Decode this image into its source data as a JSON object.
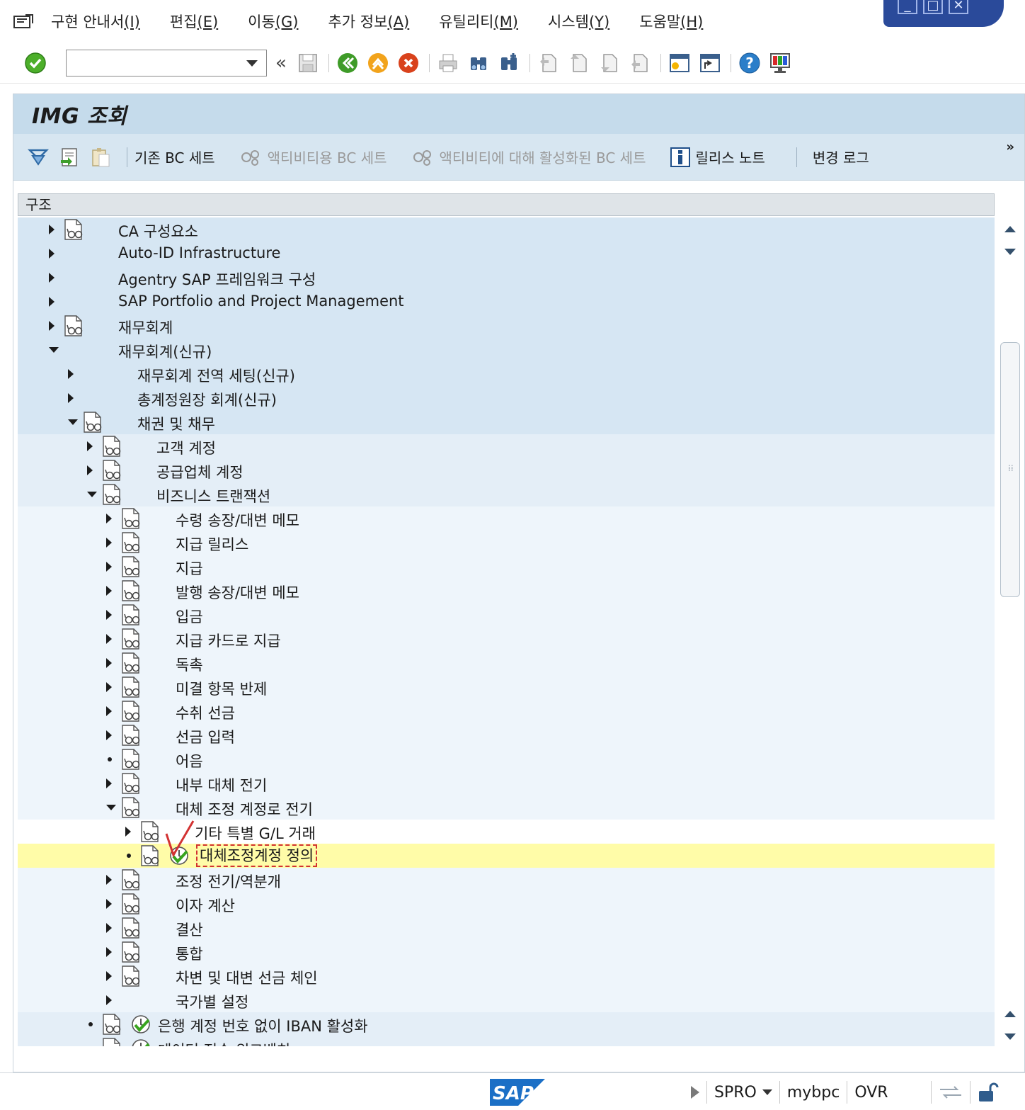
{
  "menu": {
    "items": [
      {
        "text": "구현 안내서",
        "key": "(I)"
      },
      {
        "text": "편집",
        "key": "(E)"
      },
      {
        "text": "이동",
        "key": "(G)"
      },
      {
        "text": "추가 정보",
        "key": "(A)"
      },
      {
        "text": "유틸리티",
        "key": "(M)"
      },
      {
        "text": "시스템",
        "key": "(Y)"
      },
      {
        "text": "도움말",
        "key": "(H)"
      }
    ]
  },
  "toolbar": {
    "command_value": "",
    "back_symbol": "«"
  },
  "title": "IMG 조회",
  "app_toolbar": {
    "buttons": [
      {
        "label": "기존 BC 세트",
        "enabled": true
      },
      {
        "label": "액티비티용 BC 세트",
        "enabled": false
      },
      {
        "label": "액티비티에 대해 활성화된 BC 세트",
        "enabled": false
      },
      {
        "label": "릴리스 노트",
        "enabled": true
      },
      {
        "label": "변경 로그",
        "enabled": true
      }
    ],
    "more": "»"
  },
  "tree": {
    "header": "구조",
    "rows": [
      {
        "label": "CA 구성요소",
        "level": 0,
        "state": "closed",
        "doc": true,
        "exec": false,
        "bg": "dark"
      },
      {
        "label": "Auto-ID Infrastructure",
        "level": 0,
        "state": "closed",
        "doc": false,
        "exec": false,
        "bg": "dark"
      },
      {
        "label": "Agentry SAP 프레임워크 구성",
        "level": 0,
        "state": "closed",
        "doc": false,
        "exec": false,
        "bg": "dark"
      },
      {
        "label": "SAP Portfolio and Project Management",
        "level": 0,
        "state": "closed",
        "doc": false,
        "exec": false,
        "bg": "dark"
      },
      {
        "label": "재무회계",
        "level": 0,
        "state": "closed",
        "doc": true,
        "exec": false,
        "bg": "dark"
      },
      {
        "label": "재무회계(신규)",
        "level": 0,
        "state": "open",
        "doc": false,
        "exec": false,
        "bg": "dark"
      },
      {
        "label": "재무회계 전역 세팅(신규)",
        "level": 1,
        "state": "closed",
        "doc": false,
        "exec": false,
        "bg": "dark"
      },
      {
        "label": "총계정원장 회계(신규)",
        "level": 1,
        "state": "closed",
        "doc": false,
        "exec": false,
        "bg": "dark"
      },
      {
        "label": "채권 및 채무",
        "level": 1,
        "state": "open",
        "doc": true,
        "exec": false,
        "bg": "dark"
      },
      {
        "label": "고객 계정",
        "level": 2,
        "state": "closed",
        "doc": true,
        "exec": false,
        "bg": "light"
      },
      {
        "label": "공급업체 계정",
        "level": 2,
        "state": "closed",
        "doc": true,
        "exec": false,
        "bg": "light"
      },
      {
        "label": "비즈니스 트랜잭션",
        "level": 2,
        "state": "open",
        "doc": true,
        "exec": false,
        "bg": "light"
      },
      {
        "label": "수령 송장/대변 메모",
        "level": 3,
        "state": "closed",
        "doc": true,
        "exec": false,
        "bg": "pale"
      },
      {
        "label": "지급 릴리스",
        "level": 3,
        "state": "closed",
        "doc": true,
        "exec": false,
        "bg": "pale"
      },
      {
        "label": "지급",
        "level": 3,
        "state": "closed",
        "doc": true,
        "exec": false,
        "bg": "pale"
      },
      {
        "label": "발행 송장/대변 메모",
        "level": 3,
        "state": "closed",
        "doc": true,
        "exec": false,
        "bg": "pale"
      },
      {
        "label": "입금",
        "level": 3,
        "state": "closed",
        "doc": true,
        "exec": false,
        "bg": "pale"
      },
      {
        "label": "지급 카드로 지급",
        "level": 3,
        "state": "closed",
        "doc": true,
        "exec": false,
        "bg": "pale"
      },
      {
        "label": "독촉",
        "level": 3,
        "state": "closed",
        "doc": true,
        "exec": false,
        "bg": "pale"
      },
      {
        "label": "미결 항목 반제",
        "level": 3,
        "state": "closed",
        "doc": true,
        "exec": false,
        "bg": "pale"
      },
      {
        "label": "수취 선금",
        "level": 3,
        "state": "closed",
        "doc": true,
        "exec": false,
        "bg": "pale"
      },
      {
        "label": "선금 입력",
        "level": 3,
        "state": "closed",
        "doc": true,
        "exec": false,
        "bg": "pale"
      },
      {
        "label": "어음",
        "level": 3,
        "state": "leaf",
        "doc": true,
        "exec": false,
        "bg": "pale"
      },
      {
        "label": "내부 대체 전기",
        "level": 3,
        "state": "closed",
        "doc": true,
        "exec": false,
        "bg": "pale"
      },
      {
        "label": "대체 조정 계정로 전기",
        "level": 3,
        "state": "open",
        "doc": true,
        "exec": false,
        "bg": "pale"
      },
      {
        "label": "기타 특별 G/L 거래",
        "level": 4,
        "state": "closed",
        "doc": true,
        "exec": false,
        "bg": "white"
      },
      {
        "label": "대체조정계정 정의",
        "level": 4,
        "state": "leaf",
        "doc": true,
        "exec": true,
        "bg": "hilite",
        "boxed": true
      },
      {
        "label": "조정 전기/역분개",
        "level": 3,
        "state": "closed",
        "doc": true,
        "exec": false,
        "bg": "pale"
      },
      {
        "label": "이자 계산",
        "level": 3,
        "state": "closed",
        "doc": true,
        "exec": false,
        "bg": "pale"
      },
      {
        "label": "결산",
        "level": 3,
        "state": "closed",
        "doc": true,
        "exec": false,
        "bg": "pale"
      },
      {
        "label": "통합",
        "level": 3,
        "state": "closed",
        "doc": true,
        "exec": false,
        "bg": "pale"
      },
      {
        "label": "차변 및 대변 선금 체인",
        "level": 3,
        "state": "closed",
        "doc": true,
        "exec": false,
        "bg": "pale"
      },
      {
        "label": "국가별 설정",
        "level": 3,
        "state": "closed",
        "doc": false,
        "exec": false,
        "bg": "pale"
      },
      {
        "label": "은행 계정 번호 없이 IBAN 활성화",
        "level": 2,
        "state": "leaf",
        "doc": true,
        "exec": true,
        "bg": "light"
      },
      {
        "label": "데이터 전송 워크벤치",
        "level": 2,
        "state": "leaf",
        "doc": true,
        "exec": true,
        "bg": "light"
      }
    ]
  },
  "status": {
    "brand": "SAP",
    "transaction": "SPRO",
    "server": "mybpc",
    "mode": "OVR"
  },
  "colors": {
    "title_bg": "#c5dbeb",
    "toolbar_bg": "#d7e6f1",
    "highlight": "#fffca8",
    "annotation_red": "#d23232"
  }
}
